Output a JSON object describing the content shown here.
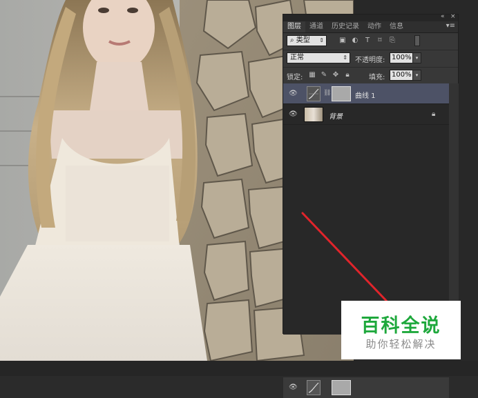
{
  "panel": {
    "tabs": [
      "图层",
      "通道",
      "历史记录",
      "动作",
      "信息"
    ],
    "active_tab": 0,
    "menu_icon": "panel-menu-icon",
    "collapse_icon": "«",
    "close_icon": "×",
    "filter": {
      "icon": "search-icon",
      "label": "类型"
    },
    "blend_mode": "正常",
    "opacity_label": "不透明度:",
    "opacity_value": "100%",
    "lock_label": "锁定:",
    "fill_label": "填充:",
    "fill_value": "100%",
    "layers": [
      {
        "name": "曲线 1",
        "selected": true,
        "type": "curves-adjustment"
      },
      {
        "name": "背景",
        "selected": false,
        "type": "background",
        "locked": true
      }
    ]
  },
  "watermark": {
    "title": "百科全说",
    "subtitle": "助你轻松解决",
    "title_color": "#1ea83c"
  },
  "annotation": {
    "color": "#e0242b"
  }
}
